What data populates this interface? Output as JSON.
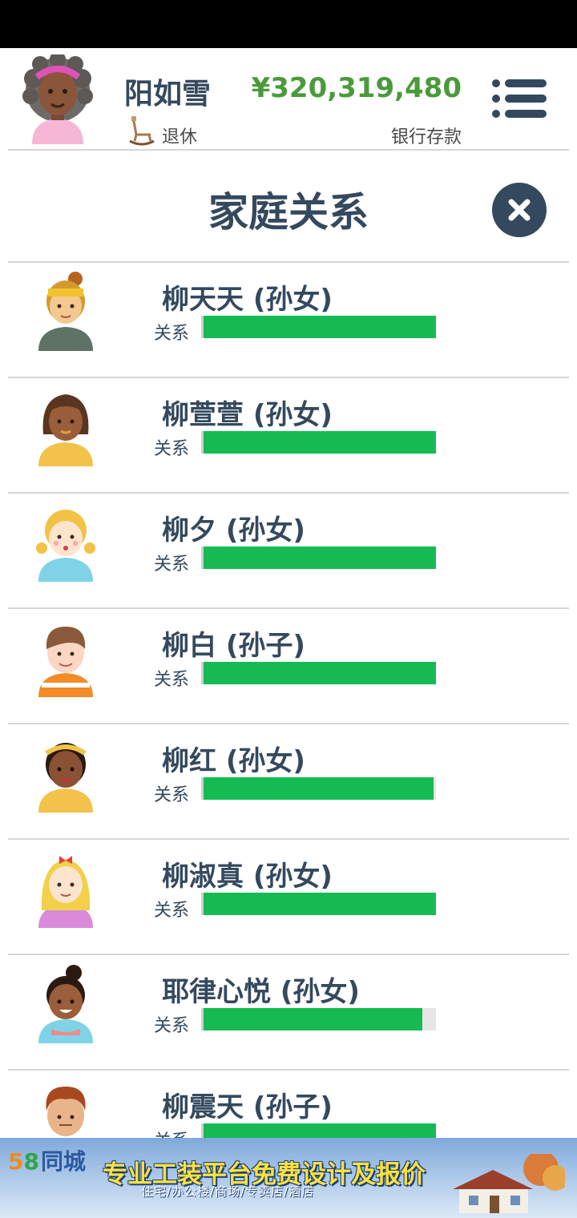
{
  "header": {
    "player_name": "阳如雪",
    "status_text": "退休",
    "money": "¥320,319,480",
    "money_label": "银行存款"
  },
  "page": {
    "title": "家庭关系"
  },
  "relationship_label": "关系",
  "family_members": [
    {
      "name": "柳天天 (孙女)",
      "relationship": 1.0
    },
    {
      "name": "柳萱萱 (孙女)",
      "relationship": 1.0
    },
    {
      "name": "柳夕 (孙女)",
      "relationship": 1.0
    },
    {
      "name": "柳白 (孙子)",
      "relationship": 1.0
    },
    {
      "name": "柳红 (孙女)",
      "relationship": 0.99
    },
    {
      "name": "柳淑真 (孙女)",
      "relationship": 1.0
    },
    {
      "name": "耶律心悦 (孙女)",
      "relationship": 0.94
    },
    {
      "name": "柳震天 (孙子)",
      "relationship": 1.0
    }
  ],
  "ad": {
    "logo_5": "5",
    "logo_8": "8",
    "logo_text": "同城",
    "headline": "专业工装平台免费设计及报价",
    "subline": "住宅/办公楼/商场/专卖店/酒店"
  },
  "colors": {
    "primary": "#34495e",
    "money": "#4a9a3c",
    "relationship_bar": "#15bb52",
    "divider": "#d6d6d6"
  }
}
